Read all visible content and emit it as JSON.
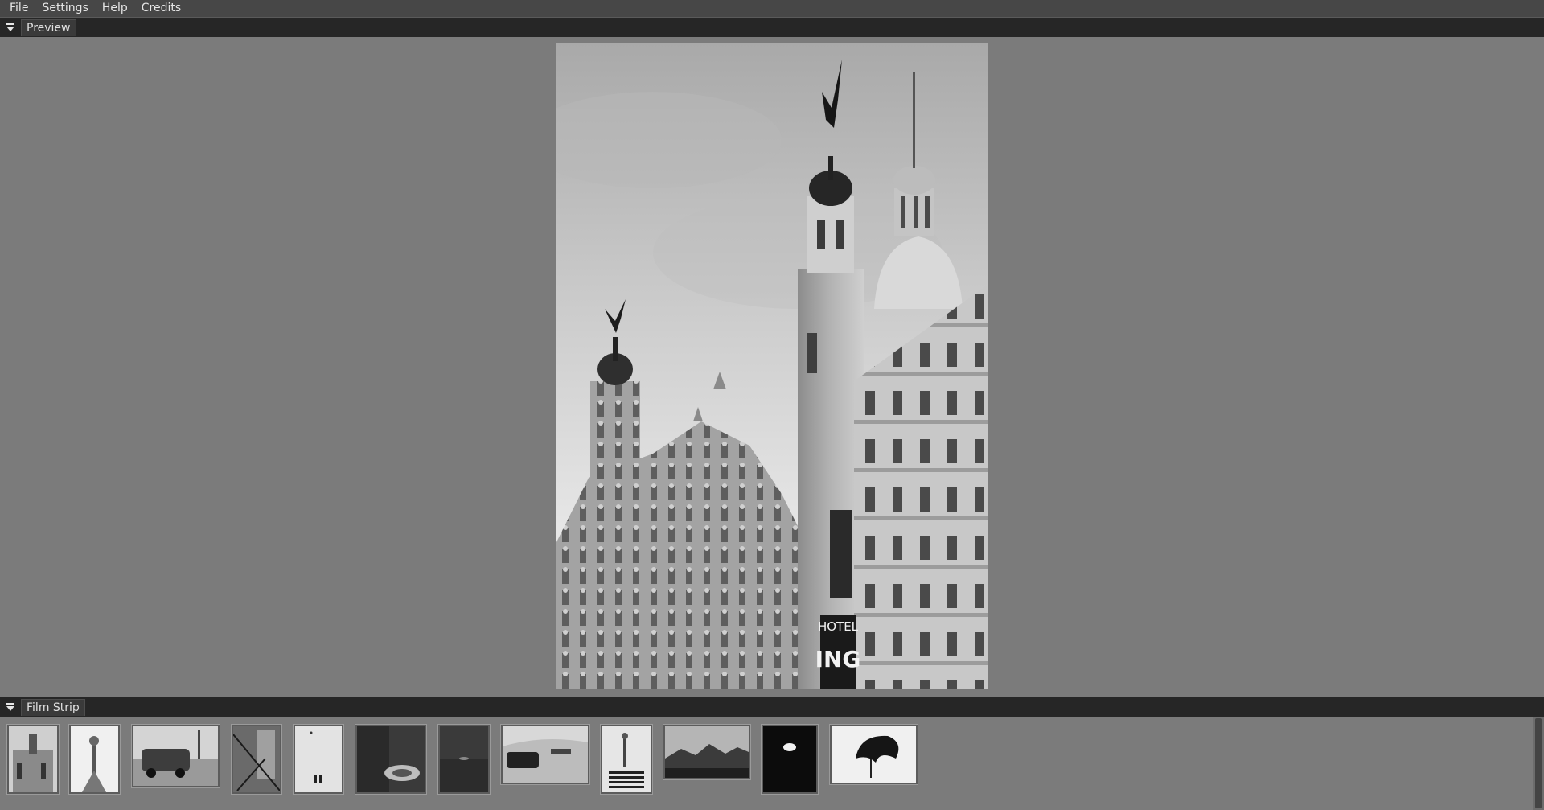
{
  "menu": {
    "file": "File",
    "settings": "Settings",
    "help": "Help",
    "credits": "Credits"
  },
  "panels": {
    "preview": {
      "title": "Preview"
    },
    "filmstrip": {
      "title": "Film Strip"
    }
  },
  "preview": {
    "sign_top": "HOTEL",
    "sign_letters": "ING"
  },
  "thumbnails": [
    {
      "subject": "ornate building"
    },
    {
      "subject": "statue of liberty"
    },
    {
      "subject": "vintage car and palms"
    },
    {
      "subject": "building with branches"
    },
    {
      "subject": "two people on snow"
    },
    {
      "subject": "old car in dark"
    },
    {
      "subject": "dark water"
    },
    {
      "subject": "car front grille"
    },
    {
      "subject": "stairs and tower"
    },
    {
      "subject": "mountain landscape"
    },
    {
      "subject": "light in darkness"
    },
    {
      "subject": "palm leaf silhouette"
    }
  ],
  "colors": {
    "background": "#7b7b7b",
    "menubar": "#474747",
    "panel_header": "#262626"
  }
}
